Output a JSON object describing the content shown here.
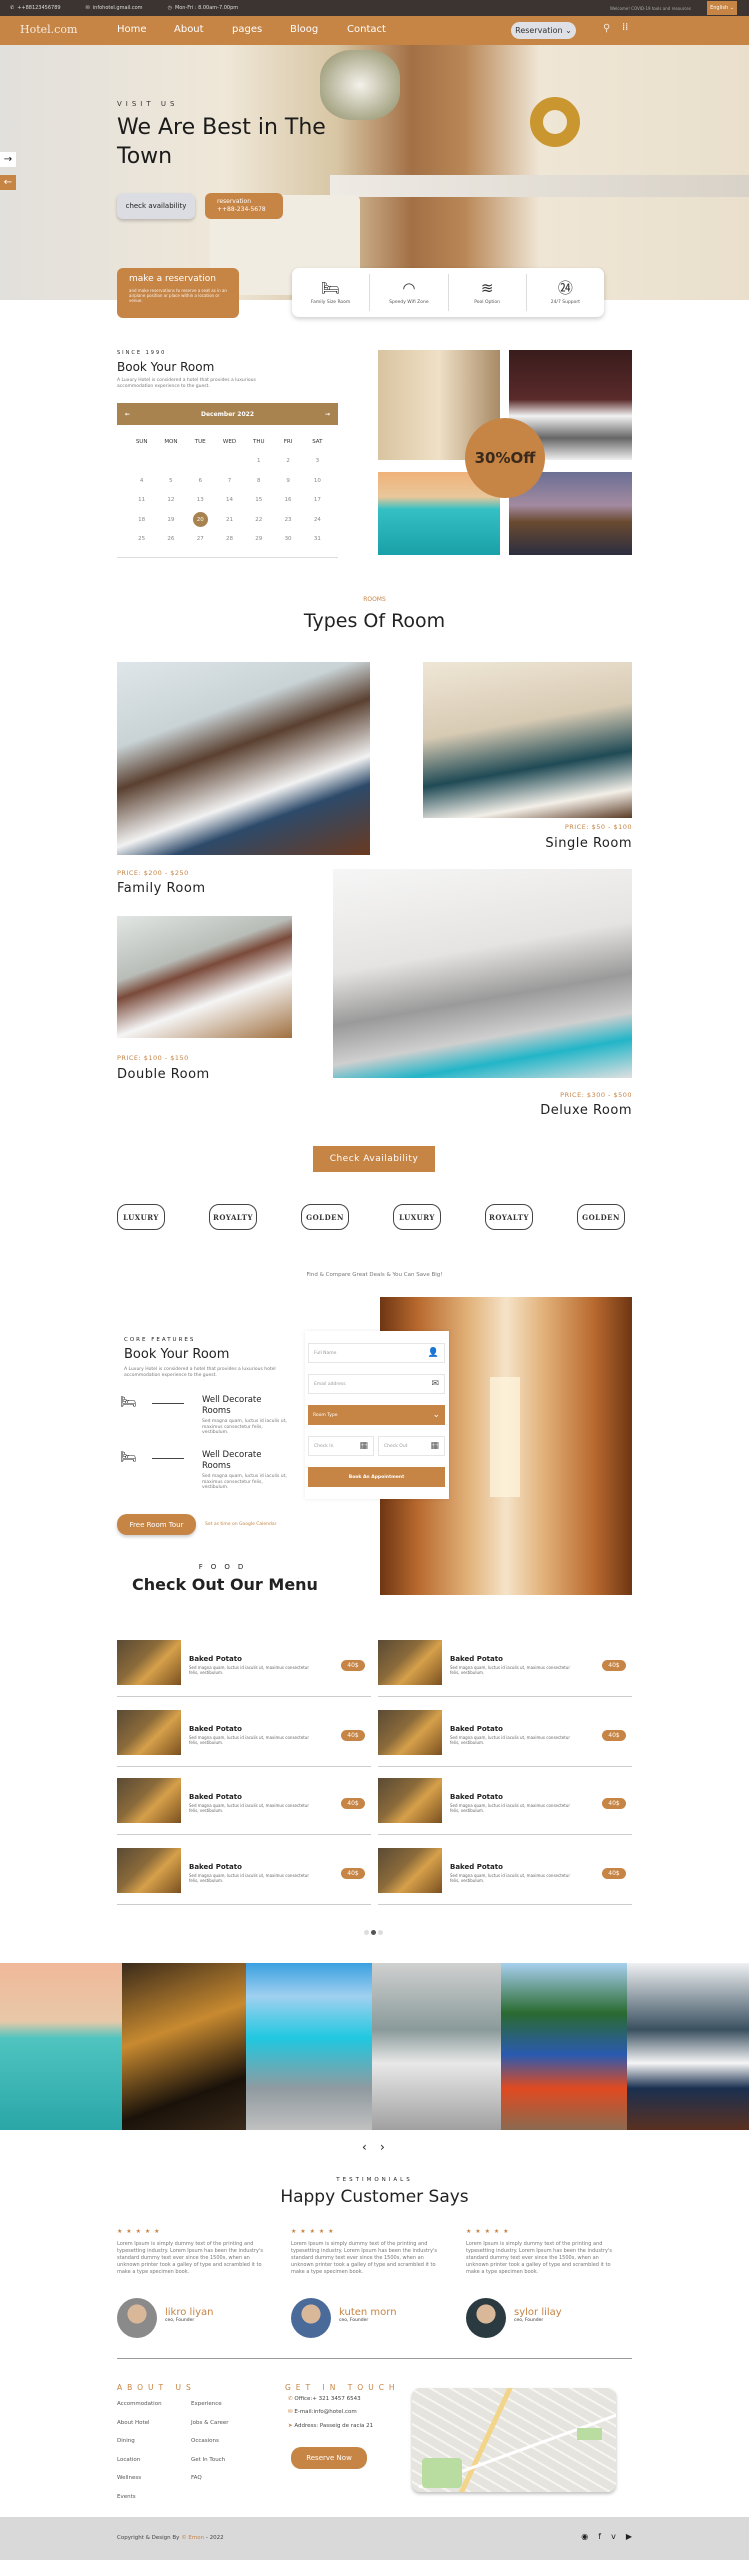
{
  "topbar": {
    "phone": "++88123456789",
    "email": "infohotel.gmail.com",
    "hours": "Mon-Fri : 8.00am-7.00pm",
    "notice": "Welcome! COVID-19 tools and resources",
    "language": "English ⌄"
  },
  "nav": {
    "logo": "Hotel.com",
    "links": [
      "Home",
      "About",
      "pages",
      "Bloog",
      "Contact"
    ],
    "reservation": "Reservation ⌄"
  },
  "hero": {
    "eyebrow": "VISIT US",
    "title": "We Are Best in The Town",
    "check_label": "check availability",
    "reservation_label": "reservation",
    "reservation_phone": "++88-234-5678",
    "make_title": "make a reservation",
    "make_desc": "and make reservations to reserve a seat as in an airplane position or place within a location or venue.",
    "features": [
      "Family Size Room",
      "Speedy Wifi Zone",
      "Pool Option",
      "24/7 Support"
    ]
  },
  "booking": {
    "eyebrow": "SINCE 1990",
    "title": "Book Your Room",
    "desc": "A Luxury Hotel is considered a hotel that provides a luxurious accommodation experience to the guest.",
    "month": "December 2022",
    "weekdays": [
      "SUN",
      "MON",
      "TUE",
      "WED",
      "THU",
      "FRI",
      "SAT"
    ],
    "selected_day": 20,
    "discount": "30%Off"
  },
  "rooms": {
    "eyebrow": "ROOMS",
    "title": "Types Of Room",
    "items": [
      {
        "name": "Family Room",
        "price": "PRICE: $200 - $250"
      },
      {
        "name": "Single Room",
        "price": "PRICE: $50 - $100"
      },
      {
        "name": "Double Room",
        "price": "PRICE: $100 - $150"
      },
      {
        "name": "Deluxe Room",
        "price": "PRICE: $300 - $500"
      }
    ],
    "cta": "Check Availability"
  },
  "brands": [
    "LUXURY",
    "ROYALTY",
    "GOLDEN",
    "LUXURY",
    "ROYALTY",
    "GOLDEN"
  ],
  "deals": "Find & Compare Great Deals & You Can Save Big!",
  "features": {
    "eyebrow": "CORE FEATURES",
    "title": "Book Your Room",
    "desc": "A Luxury Hotel is considered a hotel that provides a luxurious hotel accommodation experience to the guest.",
    "items": [
      {
        "title": "Well Decorate Rooms",
        "desc": "Sed magna quam, luctus id iaculis ut, maximus consectetur felis, vestibulum."
      },
      {
        "title": "Well Decorate Rooms",
        "desc": "Sed magna quam, luctus id iaculis ut, maximus consectetur felis, vestibulum."
      }
    ],
    "tour": "Free Room Tour",
    "calendar_link": "Set as time on Google Calendar",
    "form": {
      "name_placeholder": "Full Name",
      "email_placeholder": "Email address",
      "room_type": "Room Type",
      "check_in": "Check In",
      "check_out": "Check Out",
      "submit": "Book An Appointment"
    }
  },
  "menu": {
    "eyebrow": "FOOD",
    "title": "Check Out Our Menu",
    "items": [
      {
        "name": "Baked Potato",
        "desc": "Sed magna quam, luctus id iaculis ut, maximus consectetur felis, vestibulum.",
        "price": "40$"
      },
      {
        "name": "Baked Potato",
        "desc": "Sed magna quam, luctus id iaculis ut, maximus consectetur felis, vestibulum.",
        "price": "40$"
      },
      {
        "name": "Baked Potato",
        "desc": "Sed magna quam, luctus id iaculis ut, maximus consectetur felis, vestibulum.",
        "price": "40$"
      },
      {
        "name": "Baked Potato",
        "desc": "Sed magna quam, luctus id iaculis ut, maximus consectetur felis, vestibulum.",
        "price": "40$"
      },
      {
        "name": "Baked Potato",
        "desc": "Sed magna quam, luctus id iaculis ut, maximus consectetur felis, vestibulum.",
        "price": "40$"
      },
      {
        "name": "Baked Potato",
        "desc": "Sed magna quam, luctus id iaculis ut, maximus consectetur felis, vestibulum.",
        "price": "40$"
      },
      {
        "name": "Baked Potato",
        "desc": "Sed magna quam, luctus id iaculis ut, maximus consectetur felis, vestibulum.",
        "price": "40$"
      },
      {
        "name": "Baked Potato",
        "desc": "Sed magna quam, luctus id iaculis ut, maximus consectetur felis, vestibulum.",
        "price": "40$"
      }
    ],
    "active_page": 2,
    "pages": 3
  },
  "testimonials": {
    "eyebrow": "TESTIMONIALS",
    "title": "Happy Customer Says",
    "stars": "★ ★ ★ ★ ★",
    "items": [
      {
        "text": "Lorem Ipsum is simply dummy text of the printing and typesetting industry. Lorem Ipsum has been the industry's standard dummy text ever since the 1500s, when an unknown printer took a galley of type and scrambled it to make a type specimen book.",
        "name": "likro liyan",
        "role": "ceo, Founder"
      },
      {
        "text": "Lorem Ipsum is simply dummy text of the printing and typesetting industry. Lorem Ipsum has been the industry's standard dummy text ever since the 1500s, when an unknown printer took a galley of type and scrambled it to make a type specimen book.",
        "name": "kuten morn",
        "role": "ceo, Founder"
      },
      {
        "text": "Lorem Ipsum is simply dummy text of the printing and typesetting industry. Lorem Ipsum has been the industry's standard dummy text ever since the 1500s, when an unknown printer took a galley of type and scrambled it to make a type specimen book.",
        "name": "sylor  lilay",
        "role": "ceo, Founder"
      }
    ]
  },
  "footer": {
    "about_title": "ABOUT US",
    "links_col1": [
      "Accommodation",
      "About Hotel",
      "Dining",
      "Location",
      "Wellness",
      "Events"
    ],
    "links_col2": [
      "Experience",
      "Jobs & Career",
      "Occasions",
      "Get In Touch",
      "FAQ"
    ],
    "contact_title": "GET IN TOUCH",
    "office": "Office:+ 321 3457 6543",
    "email": "E-mail:info@hotel.com",
    "address": "Address: Passeig de racia 21",
    "reserve": "Reserve Now",
    "copyright_prefix": "Copyright & Design By",
    "author": "© Emon",
    "copyright_suffix": "- 2022"
  },
  "colors": {
    "accent": "#c68445",
    "topbar": "#3b3431",
    "calendar": "#a8834f"
  }
}
